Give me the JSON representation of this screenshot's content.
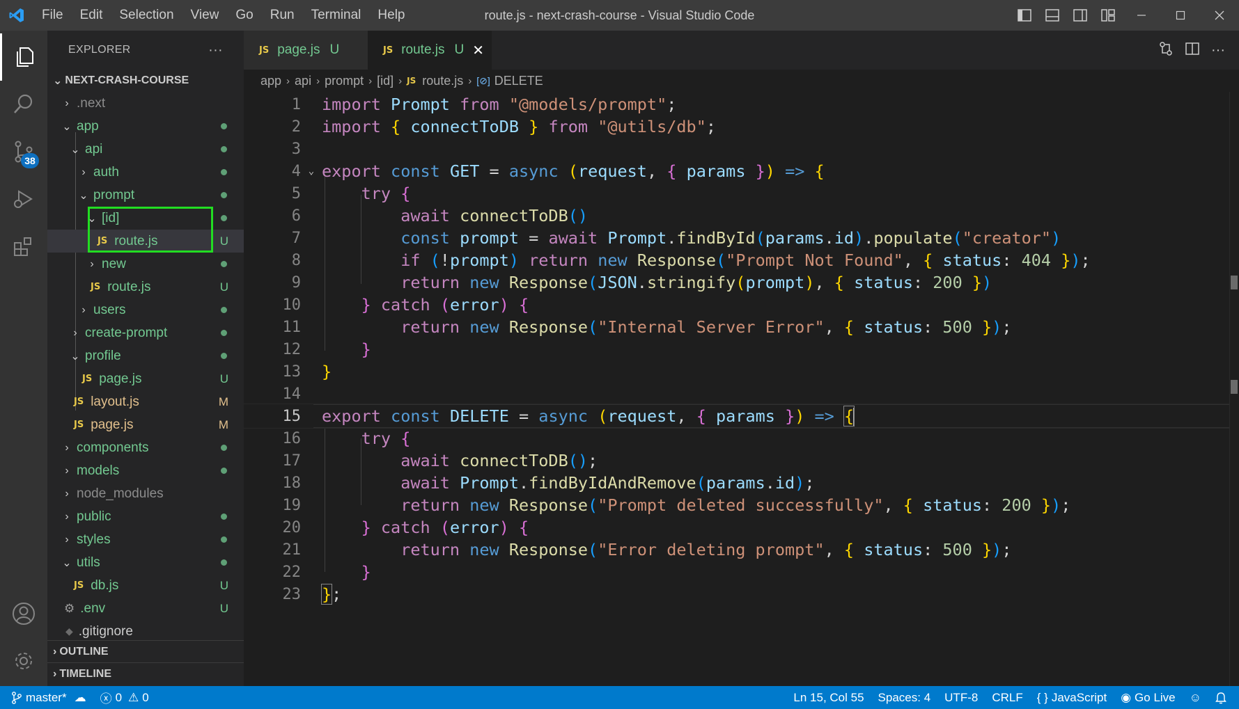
{
  "window": {
    "title": "route.js - next-crash-course - Visual Studio Code",
    "menu": [
      "File",
      "Edit",
      "Selection",
      "View",
      "Go",
      "Run",
      "Terminal",
      "Help"
    ]
  },
  "activity_bar": {
    "source_control_badge": "38"
  },
  "explorer": {
    "title": "EXPLORER",
    "more": "···",
    "project": "NEXT-CRASH-COURSE",
    "items": [
      {
        "label": ".next",
        "status": ""
      },
      {
        "label": "app",
        "status": ""
      },
      {
        "label": "api",
        "status": ""
      },
      {
        "label": "auth",
        "status": ""
      },
      {
        "label": "prompt",
        "status": ""
      },
      {
        "label": "[id]",
        "status": ""
      },
      {
        "label": "route.js",
        "status": "U"
      },
      {
        "label": "new",
        "status": ""
      },
      {
        "label": "route.js",
        "status": "U"
      },
      {
        "label": "users",
        "status": ""
      },
      {
        "label": "create-prompt",
        "status": ""
      },
      {
        "label": "profile",
        "status": ""
      },
      {
        "label": "page.js",
        "status": "U"
      },
      {
        "label": "layout.js",
        "status": "M"
      },
      {
        "label": "page.js",
        "status": "M"
      },
      {
        "label": "components",
        "status": ""
      },
      {
        "label": "models",
        "status": ""
      },
      {
        "label": "node_modules",
        "status": ""
      },
      {
        "label": "public",
        "status": ""
      },
      {
        "label": "styles",
        "status": ""
      },
      {
        "label": "utils",
        "status": ""
      },
      {
        "label": "db.js",
        "status": "U"
      },
      {
        "label": ".env",
        "status": "U"
      },
      {
        "label": ".gitignore",
        "status": ""
      }
    ],
    "outline": "OUTLINE",
    "timeline": "TIMELINE"
  },
  "tabs": [
    {
      "label": "page.js",
      "status": "U",
      "icon": "JS"
    },
    {
      "label": "route.js",
      "status": "U",
      "icon": "JS",
      "close": "✕"
    }
  ],
  "breadcrumb": [
    "app",
    "api",
    "prompt",
    "[id]",
    "route.js",
    "DELETE"
  ],
  "editor": {
    "line_numbers": [
      "1",
      "2",
      "3",
      "4",
      "5",
      "6",
      "7",
      "8",
      "9",
      "10",
      "11",
      "12",
      "13",
      "14",
      "15",
      "16",
      "17",
      "18",
      "19",
      "20",
      "21",
      "22",
      "23"
    ],
    "current_line": 15
  },
  "status_bar": {
    "branch": "master*",
    "errors": "0",
    "warnings": "0",
    "position": "Ln 15, Col 55",
    "spaces": "Spaces: 4",
    "encoding": "UTF-8",
    "eol": "CRLF",
    "language": "JavaScript",
    "golive": "Go Live"
  },
  "colors": {
    "accent": "#007acc",
    "untracked": "#73c991",
    "modified": "#e2c08d",
    "highlight_box": "#22dd22"
  }
}
